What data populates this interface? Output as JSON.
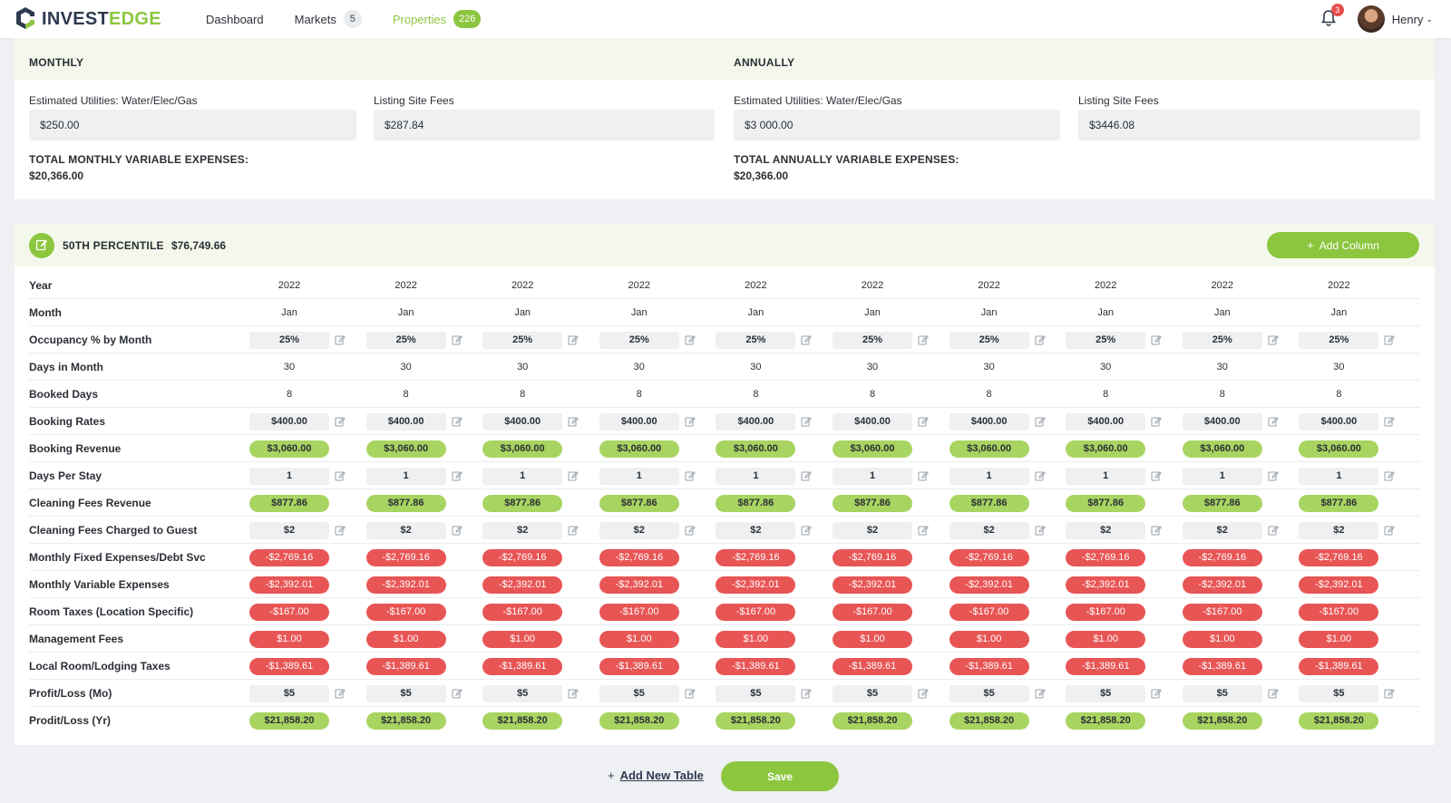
{
  "nav": {
    "logo_part1": "INVEST",
    "logo_part2": "EDGE",
    "links": [
      {
        "label": "Dashboard",
        "badge": ""
      },
      {
        "label": "Markets",
        "badge": "5"
      },
      {
        "label": "Properties",
        "badge": "226"
      }
    ],
    "notification_count": "3",
    "user_name": "Henry",
    "user_caret": "⌄",
    "icons": {
      "logo": "logo-icon",
      "bell": "bell-icon",
      "avatar": "avatar-image",
      "caret": "chevron-down-icon"
    }
  },
  "expenses": {
    "monthly": {
      "title": "MONTHLY",
      "utilities_label": "Estimated Utilities: Water/Elec/Gas",
      "utilities_value": "$250.00",
      "listing_label": "Listing Site Fees",
      "listing_value": "$287.84",
      "total_label": "TOTAL MONTHLY VARIABLE EXPENSES:",
      "total_value": "$20,366.00"
    },
    "annually": {
      "title": "ANNUALLY",
      "utilities_label": "Estimated Utilities: Water/Elec/Gas",
      "utilities_value": "$3 000.00",
      "listing_label": "Listing Site Fees",
      "listing_value": "$3446.08",
      "total_label": "TOTAL ANNUALLY VARIABLE EXPENSES:",
      "total_value": "$20,366.00"
    }
  },
  "percentile": {
    "title": "50TH PERCENTILE",
    "value": "$76,749.66",
    "add_column_label": "Add Column",
    "add_icon": "plus-icon",
    "edit_icon": "edit-icon"
  },
  "table": {
    "column_count": 10,
    "rows": [
      {
        "label": "Year",
        "style": "plain",
        "value": "2022",
        "editable": false
      },
      {
        "label": "Month",
        "style": "plain",
        "value": "Jan",
        "editable": false
      },
      {
        "label": "Occupancy % by Month",
        "style": "box",
        "value": "25%",
        "editable": true
      },
      {
        "label": "Days in Month",
        "style": "plain",
        "value": "30",
        "editable": false
      },
      {
        "label": "Booked Days",
        "style": "plain",
        "value": "8",
        "editable": false
      },
      {
        "label": "Booking Rates",
        "style": "box",
        "value": "$400.00",
        "editable": true
      },
      {
        "label": "Booking Revenue",
        "style": "green",
        "value": "$3,060.00",
        "editable": false
      },
      {
        "label": "Days Per Stay",
        "style": "box",
        "value": "1",
        "editable": true
      },
      {
        "label": "Cleaning Fees Revenue",
        "style": "green",
        "value": "$877.86",
        "editable": false
      },
      {
        "label": "Cleaning Fees Charged to Guest",
        "style": "box",
        "value": "$2",
        "editable": true
      },
      {
        "label": "Monthly Fixed Expenses/Debt Svc",
        "style": "red",
        "value": "-$2,769.16",
        "editable": false
      },
      {
        "label": "Monthly Variable Expenses",
        "style": "red",
        "value": "-$2,392.01",
        "editable": false
      },
      {
        "label": "Room Taxes (Location Specific)",
        "style": "red",
        "value": "-$167.00",
        "editable": false
      },
      {
        "label": "Management Fees",
        "style": "red",
        "value": "$1.00",
        "editable": false
      },
      {
        "label": "Local Room/Lodging Taxes",
        "style": "red",
        "value": "-$1,389.61",
        "editable": false
      },
      {
        "label": "Profit/Loss (Mo)",
        "style": "box",
        "value": "$5",
        "editable": true
      },
      {
        "label": "Prodit/Loss (Yr)",
        "style": "green",
        "value": "$21,858.20",
        "editable": false
      }
    ]
  },
  "footer": {
    "add_table_label": "Add New Table",
    "save_label": "Save"
  },
  "colors": {
    "accent": "#8cc63f",
    "positive": "#a8d461",
    "negative": "#e85555",
    "header_tint": "#f4f8ec"
  }
}
